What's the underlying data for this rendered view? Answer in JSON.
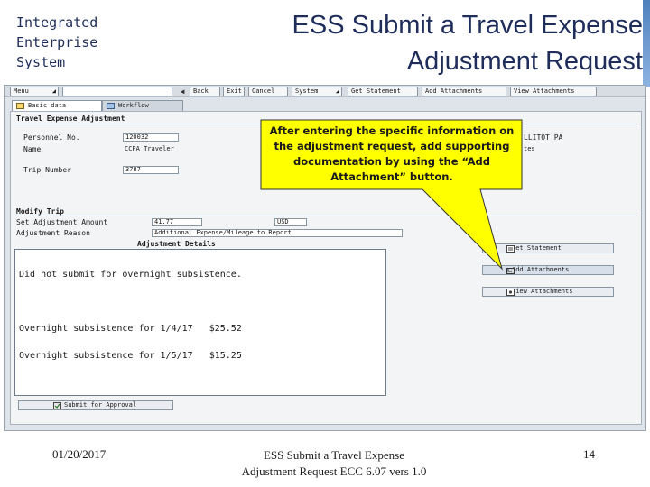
{
  "slide": {
    "org_lines": [
      "Integrated",
      "Enterprise",
      "System"
    ],
    "title_lines": [
      "ESS Submit a Travel Expense",
      "Adjustment Request"
    ],
    "accent_color": "#4f81bd"
  },
  "toolbar": {
    "menu_label": "Menu",
    "buttons": [
      "Back",
      "Exit",
      "Cancel",
      "System",
      "Get Statement",
      "Add Attachments",
      "View Attachments"
    ]
  },
  "tabs": [
    "Basic data",
    "Workflow"
  ],
  "travel_adjustment": {
    "group_title": "Travel Expense Adjustment",
    "personnel_label": "Personnel No.",
    "personnel_value": "120032",
    "name_label": "Name",
    "name_value": "CCPA Traveler",
    "trip_label": "Trip Number",
    "trip_value": "3787",
    "right_info_1": "LLITOT PA",
    "right_info_2": "tes"
  },
  "modify_trip": {
    "group_title": "Modify Trip",
    "amount_label": "Set Adjustment Amount",
    "amount_value": "41.77",
    "currency_value": "USD",
    "reason_label": "Adjustment Reason",
    "reason_value": "Additional Expense/Mileage to Report",
    "details_label": "Adjustment Details",
    "detail_lines": [
      "Did not submit for overnight subsistence.",
      "",
      "Overnight subsistence for 1/4/17   $25.52",
      "Overnight subsistence for 1/5/17   $15.25"
    ]
  },
  "side_buttons": [
    "Get Statement",
    "Add Attachments",
    "View Attachments"
  ],
  "submit_label": "Submit for Approval",
  "callout": {
    "text": "After entering the specific information on the adjustment request, add supporting documentation by using the “Add Attachment” button.",
    "fill_color": "#ffff00"
  },
  "footer": {
    "date": "01/20/2017",
    "center_lines": [
      "ESS Submit a Travel Expense",
      "Adjustment Request ECC 6.07 vers 1.0"
    ],
    "page_number": "14"
  }
}
